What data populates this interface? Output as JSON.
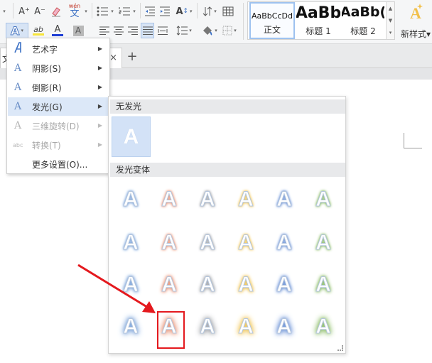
{
  "toolbar": {
    "row1": {
      "grow_font": "A⁺",
      "shrink_font": "A⁻",
      "wen_top": "wén",
      "wen_bottom": "文"
    },
    "row2": {
      "text_effect": "A",
      "highlight": "ab",
      "font_color": "A",
      "char_shade": "A"
    },
    "styles": [
      {
        "preview": "AaBbCcDd",
        "name": "正文"
      },
      {
        "preview": "AaBb",
        "name": "标题 1"
      },
      {
        "preview": "AaBb(",
        "name": "标题 2"
      }
    ],
    "new_style_label": "新样式",
    "new_style_arrow": "▾"
  },
  "tabs": {
    "doc_tab_text": "文",
    "close": "×",
    "new_tab": "+"
  },
  "effect_menu": {
    "items": [
      {
        "label": "艺术字",
        "submenu": true,
        "enabled": true
      },
      {
        "label": "阴影(S)",
        "submenu": true,
        "enabled": true
      },
      {
        "label": "倒影(R)",
        "submenu": true,
        "enabled": true
      },
      {
        "label": "发光(G)",
        "submenu": true,
        "enabled": true,
        "highlighted": true
      },
      {
        "label": "三维旋转(D)",
        "submenu": true,
        "enabled": false
      },
      {
        "label": "转换(T)",
        "submenu": true,
        "enabled": false
      },
      {
        "label": "更多设置(O)...",
        "submenu": false,
        "enabled": true
      }
    ],
    "transform_icon_text": "abc"
  },
  "glow_panel": {
    "no_glow_header": "无发光",
    "variants_header": "发光变体",
    "glyph": "A",
    "glow_colors": [
      "#7fa6db",
      "#e9967a",
      "#a6a9ae",
      "#f0c75a",
      "#6f95d8",
      "#8fbf6b"
    ],
    "glow_rows": [
      "small",
      "small",
      "medium",
      "large"
    ],
    "selected": {
      "row": 4,
      "col": 2
    }
  },
  "annotation": {
    "highlight_color": "#e4191e"
  }
}
